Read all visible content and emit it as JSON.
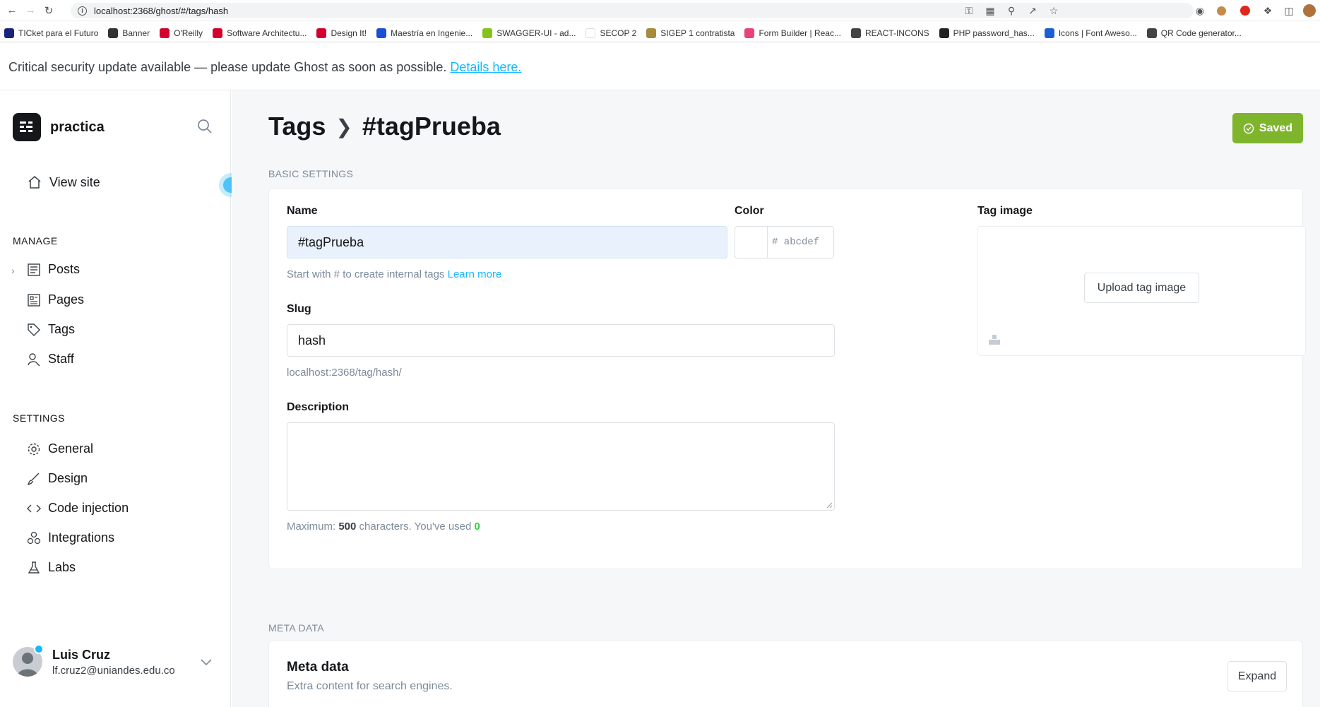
{
  "browser": {
    "url": "localhost:2368/ghost/#/tags/hash",
    "bookmarks": [
      {
        "label": "TICket para el Futuro",
        "icon": "ticket-favicon",
        "color": "#1a237e"
      },
      {
        "label": "Banner",
        "icon": "banner-favicon",
        "color": "#333333"
      },
      {
        "label": "O'Reilly",
        "icon": "oreilly-favicon",
        "color": "#d3002d"
      },
      {
        "label": "Software Architectu...",
        "icon": "oreilly-favicon",
        "color": "#d3002d"
      },
      {
        "label": "Design It!",
        "icon": "oreilly-favicon",
        "color": "#d3002d"
      },
      {
        "label": "Maestría en Ingenie...",
        "icon": "uniandes-favicon",
        "color": "#1a4fd6"
      },
      {
        "label": "SWAGGER-UI - ad...",
        "icon": "swagger-favicon",
        "color": "#85c21b"
      },
      {
        "label": "SECOP 2",
        "icon": "secop-favicon",
        "color": "#ffffff"
      },
      {
        "label": "SIGEP 1 contratista",
        "icon": "sigep-favicon",
        "color": "#a68b3c"
      },
      {
        "label": "Form Builder | Reac...",
        "icon": "formbuilder-favicon",
        "color": "#e8437a"
      },
      {
        "label": "REACT-INCONS",
        "icon": "globe-favicon",
        "color": "#444444"
      },
      {
        "label": "PHP password_has...",
        "icon": "php-favicon",
        "color": "#222222"
      },
      {
        "label": "Icons | Font Aweso...",
        "icon": "flag-favicon",
        "color": "#1a5fd6"
      },
      {
        "label": "QR Code generator...",
        "icon": "globe-favicon",
        "color": "#444444"
      }
    ]
  },
  "alert": {
    "text": "Critical security update available — please update Ghost as soon as possible.",
    "link": "Details here."
  },
  "sidebar": {
    "site_name": "practica",
    "view_site": "View site",
    "manage_heading": "MANAGE",
    "manage_items": [
      {
        "label": "Posts",
        "icon": "posts-icon"
      },
      {
        "label": "Pages",
        "icon": "pages-icon"
      },
      {
        "label": "Tags",
        "icon": "tag-icon"
      },
      {
        "label": "Staff",
        "icon": "staff-icon"
      }
    ],
    "settings_heading": "SETTINGS",
    "settings_items": [
      {
        "label": "General",
        "icon": "gear-icon"
      },
      {
        "label": "Design",
        "icon": "brush-icon"
      },
      {
        "label": "Code injection",
        "icon": "code-icon"
      },
      {
        "label": "Integrations",
        "icon": "integrations-icon"
      },
      {
        "label": "Labs",
        "icon": "flask-icon"
      }
    ],
    "user": {
      "name": "Luis Cruz",
      "email": "lf.cruz2@uniandes.edu.co"
    }
  },
  "main": {
    "breadcrumb_parent": "Tags",
    "breadcrumb_current": "#tagPrueba",
    "saved_label": "Saved",
    "basic_settings_title": "BASIC SETTINGS",
    "name_label": "Name",
    "name_value": "#tagPrueba",
    "name_hint": "Start with # to create internal tags",
    "name_hint_link": "Learn more",
    "color_label": "Color",
    "color_placeholder": "# abcdef",
    "slug_label": "Slug",
    "slug_value": "hash",
    "slug_url": "localhost:2368/tag/hash/",
    "description_label": "Description",
    "description_hint_prefix": "Maximum:",
    "description_max": "500",
    "description_hint_mid": "characters. You've used",
    "description_used": "0",
    "tag_image_label": "Tag image",
    "upload_label": "Upload tag image",
    "meta_section_title": "META DATA",
    "meta_title": "Meta data",
    "meta_subtitle": "Extra content for search engines.",
    "expand_label": "Expand"
  },
  "colors": {
    "accent_green": "#7fb52d",
    "link_blue": "#14b8ff",
    "used_count_green": "#30cf43"
  }
}
